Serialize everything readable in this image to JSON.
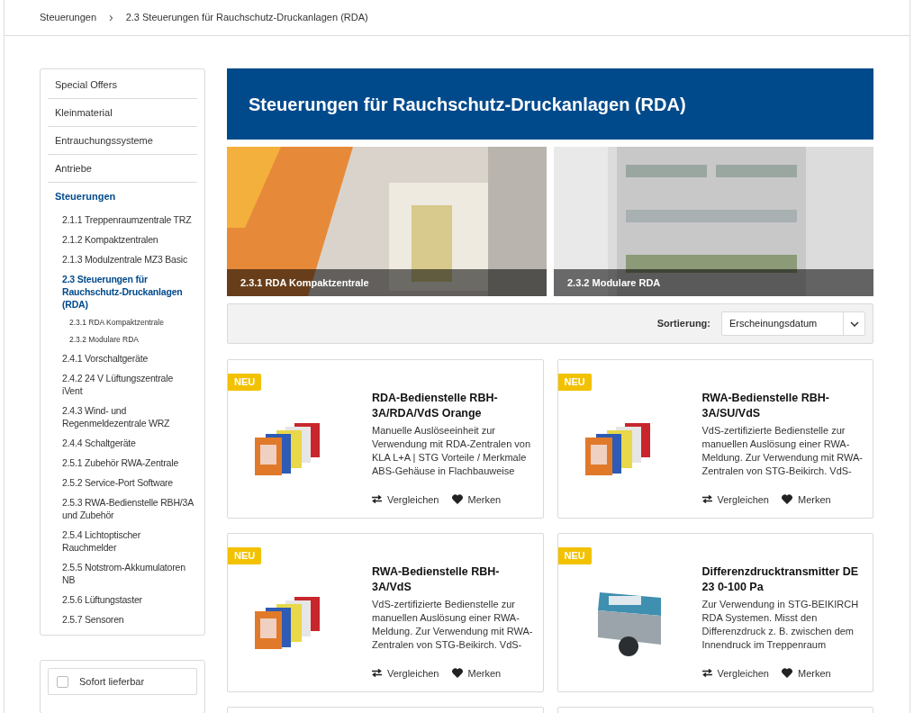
{
  "breadcrumb": [
    "Steuerungen",
    "2.3 Steuerungen für Rauchschutz-Druckanlagen (RDA)"
  ],
  "breadcrumb_separator": "›",
  "sidebar": {
    "items": [
      {
        "label": "Special Offers",
        "selected": false
      },
      {
        "label": "Kleinmaterial",
        "selected": false
      },
      {
        "label": "Entrauchungssysteme",
        "selected": false
      },
      {
        "label": "Antriebe",
        "selected": false
      },
      {
        "label": "Steuerungen",
        "selected": true,
        "children": [
          {
            "label": "2.1.1 Treppenraumzentrale TRZ",
            "selected": false
          },
          {
            "label": "2.1.2 Kompaktzentralen",
            "selected": false
          },
          {
            "label": "2.1.3 Modulzentrale MZ3 Basic",
            "selected": false
          },
          {
            "label": "2.3 Steuerungen für Rauchschutz-Druckanlagen (RDA)",
            "selected": true,
            "children": [
              {
                "label": "2.3.1 RDA Kompaktzentrale",
                "selected": false
              },
              {
                "label": "2.3.2 Modulare RDA",
                "selected": false
              }
            ]
          },
          {
            "label": "2.4.1 Vorschaltgeräte",
            "selected": false
          },
          {
            "label": "2.4.2 24 V Lüftungszentrale iVent",
            "selected": false
          },
          {
            "label": "2.4.3 Wind- und Regenmeldezentrale WRZ",
            "selected": false
          },
          {
            "label": "2.4.4 Schaltgeräte",
            "selected": false
          },
          {
            "label": "2.5.1 Zubehör RWA-Zentrale",
            "selected": false
          },
          {
            "label": "2.5.2 Service-Port Software",
            "selected": false
          },
          {
            "label": "2.5.3 RWA-Bedienstelle RBH/3A und Zubehör",
            "selected": false
          },
          {
            "label": "2.5.4 Lichtoptischer Rauchmelder",
            "selected": false
          },
          {
            "label": "2.5.5 Notstrom-Akkumulatoren NB",
            "selected": false
          },
          {
            "label": "2.5.6 Lüftungstaster",
            "selected": false
          },
          {
            "label": "2.5.7 Sensoren",
            "selected": false
          }
        ]
      }
    ]
  },
  "filter": {
    "label": "Sofort lieferbar",
    "checked": false
  },
  "title": "Steuerungen für Rauchschutz-Druckanlagen (RDA)",
  "categories": [
    {
      "label": "2.3.1 RDA Kompaktzentrale",
      "kind": "stairwell"
    },
    {
      "label": "2.3.2 Modulare RDA",
      "kind": "cabinet"
    }
  ],
  "sort": {
    "label": "Sortierung:",
    "value": "Erscheinungsdatum"
  },
  "products": [
    {
      "badge": "NEU",
      "name": "RDA-Bedienstelle RBH-3A/RDA/VdS Orange",
      "description": "Manuelle Auslöseeinheit zur Verwendung mit RDA-Zentralen von KLA L+A | STG Vorteile / Merkmale ABS-Gehäuse in Flachbauweise",
      "kind": "call-point",
      "compare": "Vergleichen",
      "remember": "Merken"
    },
    {
      "badge": "NEU",
      "name": "RWA-Bedienstelle RBH-3A/SU/VdS",
      "description": "VdS-zertifizierte Bedienstelle zur manuellen Auslösung einer RWA-Meldung. Zur Verwendung mit RWA-Zentralen von STG-Beikirch. VdS-",
      "kind": "call-point",
      "compare": "Vergleichen",
      "remember": "Merken"
    },
    {
      "badge": "NEU",
      "name": "RWA-Bedienstelle RBH-3A/VdS",
      "description": "VdS-zertifizierte Bedienstelle zur manuellen Auslösung einer RWA-Meldung. Zur Verwendung mit RWA-Zentralen von STG-Beikirch. VdS-",
      "kind": "call-point",
      "compare": "Vergleichen",
      "remember": "Merken"
    },
    {
      "badge": "NEU",
      "name": "Differenzdrucktransmitter DE 23 0-100 Pa",
      "description": "Zur Verwendung in STG-BEIKIRCH RDA Systemen. Misst den Differenzdruck z. B. zwischen dem Innendruck im Treppenraum",
      "kind": "transmitter",
      "compare": "Vergleichen",
      "remember": "Merken"
    }
  ]
}
